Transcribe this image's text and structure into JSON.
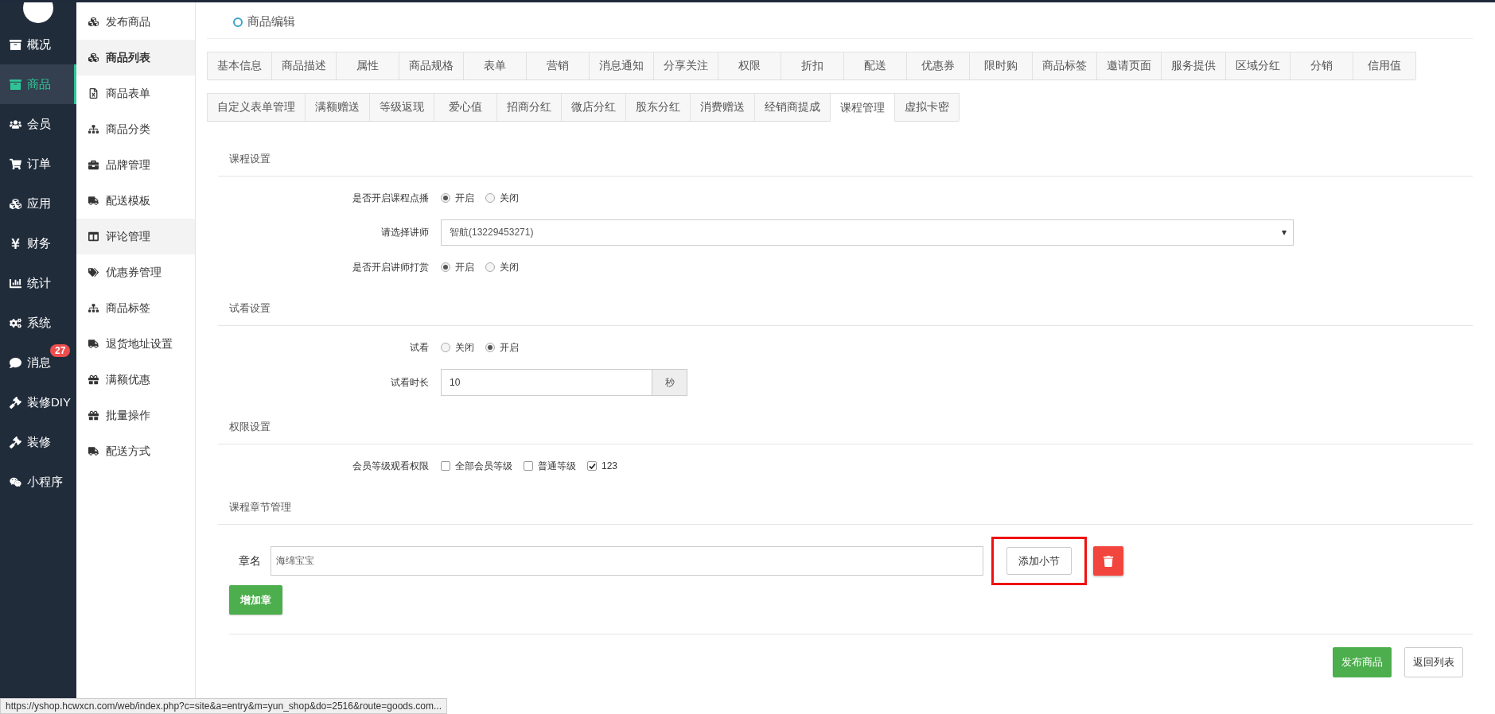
{
  "sidebar": {
    "items": [
      {
        "label": "概况",
        "selected": false
      },
      {
        "label": "商品",
        "selected": true
      },
      {
        "label": "会员",
        "selected": false
      },
      {
        "label": "订单",
        "selected": false
      },
      {
        "label": "应用",
        "selected": false
      },
      {
        "label": "财务",
        "selected": false
      },
      {
        "label": "统计",
        "selected": false
      },
      {
        "label": "系统",
        "selected": false
      },
      {
        "label": "消息",
        "selected": false,
        "badge": "27"
      },
      {
        "label": "装修DIY",
        "selected": false
      },
      {
        "label": "装修",
        "selected": false
      },
      {
        "label": "小程序",
        "selected": false
      }
    ]
  },
  "subnav": {
    "items": [
      {
        "label": "发布商品",
        "selected": false,
        "hovered": false
      },
      {
        "label": "商品列表",
        "selected": true,
        "hovered": false
      },
      {
        "label": "商品表单",
        "selected": false,
        "hovered": false
      },
      {
        "label": "商品分类",
        "selected": false,
        "hovered": false
      },
      {
        "label": "品牌管理",
        "selected": false,
        "hovered": false
      },
      {
        "label": "配送模板",
        "selected": false,
        "hovered": false
      },
      {
        "label": "评论管理",
        "selected": false,
        "hovered": true
      },
      {
        "label": "优惠券管理",
        "selected": false,
        "hovered": false
      },
      {
        "label": "商品标签",
        "selected": false,
        "hovered": false
      },
      {
        "label": "退货地址设置",
        "selected": false,
        "hovered": false
      },
      {
        "label": "满额优惠",
        "selected": false,
        "hovered": false
      },
      {
        "label": "批量操作",
        "selected": false,
        "hovered": false
      },
      {
        "label": "配送方式",
        "selected": false,
        "hovered": false
      }
    ]
  },
  "page_title": "商品编辑",
  "tab_rows": [
    [
      {
        "label": "基本信息",
        "selected": false
      },
      {
        "label": "商品描述",
        "selected": false
      },
      {
        "label": "属性",
        "selected": false
      },
      {
        "label": "商品规格",
        "selected": false
      },
      {
        "label": "表单",
        "selected": false
      },
      {
        "label": "营销",
        "selected": false
      },
      {
        "label": "消息通知",
        "selected": false
      },
      {
        "label": "分享关注",
        "selected": false
      },
      {
        "label": "权限",
        "selected": false
      },
      {
        "label": "折扣",
        "selected": false
      },
      {
        "label": "配送",
        "selected": false
      },
      {
        "label": "优惠券",
        "selected": false
      },
      {
        "label": "限时购",
        "selected": false
      },
      {
        "label": "商品标签",
        "selected": false
      },
      {
        "label": "邀请页面",
        "selected": false
      },
      {
        "label": "服务提供",
        "selected": false
      },
      {
        "label": "区域分红",
        "selected": false
      },
      {
        "label": "分销",
        "selected": false
      },
      {
        "label": "信用值",
        "selected": false
      }
    ],
    [
      {
        "label": "自定义表单管理",
        "selected": false
      },
      {
        "label": "满额赠送",
        "selected": false
      },
      {
        "label": "等级返现",
        "selected": false
      },
      {
        "label": "爱心值",
        "selected": false
      },
      {
        "label": "招商分红",
        "selected": false
      },
      {
        "label": "微店分红",
        "selected": false
      },
      {
        "label": "股东分红",
        "selected": false
      },
      {
        "label": "消费赠送",
        "selected": false
      },
      {
        "label": "经销商提成",
        "selected": false
      },
      {
        "label": "课程管理",
        "selected": true
      },
      {
        "label": "虚拟卡密",
        "selected": false
      }
    ]
  ],
  "sections": [
    {
      "title": "课程设置",
      "rows": [
        {
          "kind": "radio",
          "label": "是否开启课程点播",
          "options": [
            {
              "label": "开启",
              "selected": true
            },
            {
              "label": "关闭",
              "selected": false
            }
          ]
        },
        {
          "kind": "select",
          "label": "请选择讲师",
          "value": "智航(13229453271)"
        },
        {
          "kind": "radio",
          "label": "是否开启讲师打赏",
          "options": [
            {
              "label": "开启",
              "selected": true
            },
            {
              "label": "关闭",
              "selected": false
            }
          ]
        }
      ]
    },
    {
      "title": "试看设置",
      "rows": [
        {
          "kind": "radio",
          "label": "试看",
          "options": [
            {
              "label": "关闭",
              "selected": false
            },
            {
              "label": "开启",
              "selected": true
            }
          ]
        },
        {
          "kind": "input",
          "label": "试看时长",
          "value": "10",
          "addon": "秒"
        }
      ]
    },
    {
      "title": "权限设置",
      "rows": [
        {
          "kind": "checkbox",
          "label": "会员等级观看权限",
          "options": [
            {
              "label": "全部会员等级",
              "checked": false
            },
            {
              "label": "普通等级",
              "checked": false
            },
            {
              "label": "123",
              "checked": true
            }
          ]
        }
      ]
    }
  ],
  "chapters": {
    "title": "课程章节管理",
    "items": [
      {
        "label": "章名",
        "value": "海绵宝宝",
        "add_button": "添加小节",
        "highlighted": true
      }
    ],
    "add_button": "增加章"
  },
  "footer_buttons": [
    {
      "label": "发布商品",
      "kind": "primary"
    },
    {
      "label": "返回列表",
      "kind": "default"
    }
  ],
  "status_url": "https://yshop.hcwxcn.com/web/index.php?c=site&a=entry&m=yun_shop&do=2516&route=goods.com..."
}
